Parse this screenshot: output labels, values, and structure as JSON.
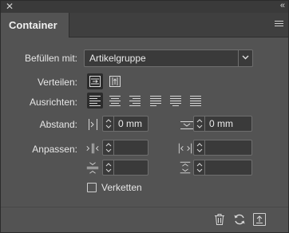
{
  "panel": {
    "close_glyph": "✕",
    "collapse_glyph": "«",
    "tab_label": "Container",
    "menu_icon": "hamburger-menu-icon"
  },
  "befuellen": {
    "label": "Befüllen mit:",
    "value": "Artikelgruppe",
    "dropdown_icon": "chevron-down-icon"
  },
  "verteilen": {
    "label": "Verteilen:",
    "options": [
      {
        "icon": "distribute-horizontal-icon",
        "active": true
      },
      {
        "icon": "distribute-vertical-icon",
        "active": false
      }
    ]
  },
  "ausrichten": {
    "label": "Ausrichten:",
    "options": [
      {
        "icon": "align-left-icon",
        "active": true
      },
      {
        "icon": "align-center-icon",
        "active": false
      },
      {
        "icon": "align-right-icon",
        "active": false
      },
      {
        "icon": "justify-left-icon",
        "active": false
      },
      {
        "icon": "justify-center-icon",
        "active": false
      },
      {
        "icon": "justify-all-icon",
        "active": false
      }
    ]
  },
  "abstand": {
    "label": "Abstand:",
    "horizontal": {
      "value": "0 mm",
      "icon": "horizontal-spacing-icon"
    },
    "vertical": {
      "value": "0 mm",
      "icon": "vertical-spacing-icon"
    }
  },
  "anpassen": {
    "label": "Anpassen:",
    "fields": [
      {
        "value": "",
        "icon": "fit-width-inner-icon"
      },
      {
        "value": "",
        "icon": "fit-width-outer-icon"
      },
      {
        "value": "",
        "icon": "fit-height-inner-icon"
      },
      {
        "value": "",
        "icon": "fit-height-outer-icon"
      }
    ]
  },
  "verketten": {
    "label": "Verketten",
    "checked": false
  },
  "footer": {
    "buttons": [
      "trash-icon",
      "refresh-icon",
      "export-icon"
    ]
  }
}
